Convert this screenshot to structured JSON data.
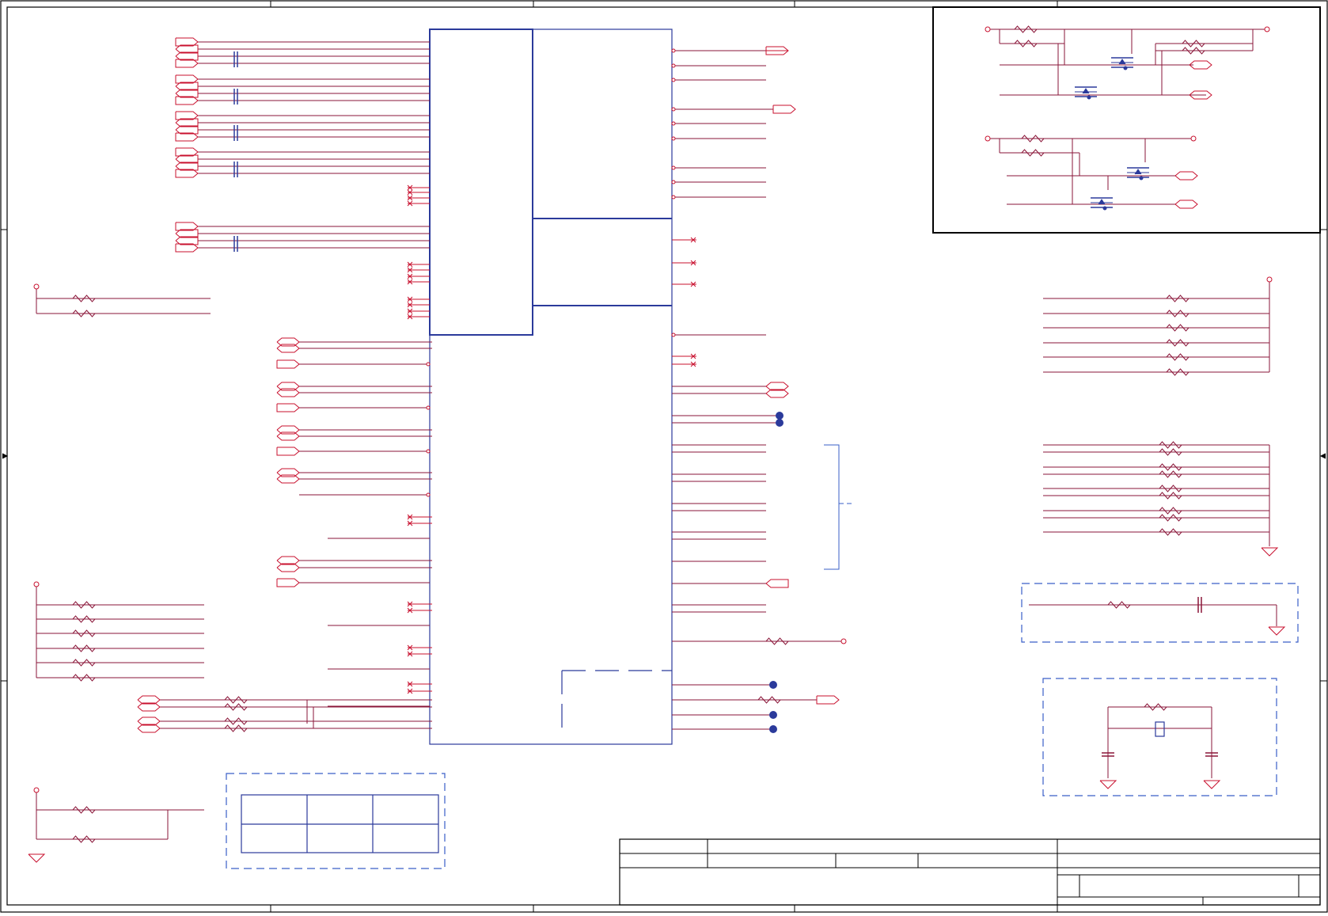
{
  "sheet": {
    "colors": {
      "border": "#000000",
      "wire": "#c8102e",
      "net": "#8a1538",
      "component": "#2b3a9b",
      "dashed_box": "#3a5fc7"
    }
  },
  "title_block": {
    "fields": []
  },
  "icons": {
    "resistor": "resistor-icon",
    "capacitor": "capacitor-icon",
    "ground": "ground-icon",
    "mosfet": "mosfet-icon",
    "crystal": "crystal-icon",
    "off_page_connector": "off-page-connector-icon",
    "no_connect": "no-connect-icon",
    "power_pin": "power-pin-icon",
    "test_point": "test-point-icon"
  }
}
